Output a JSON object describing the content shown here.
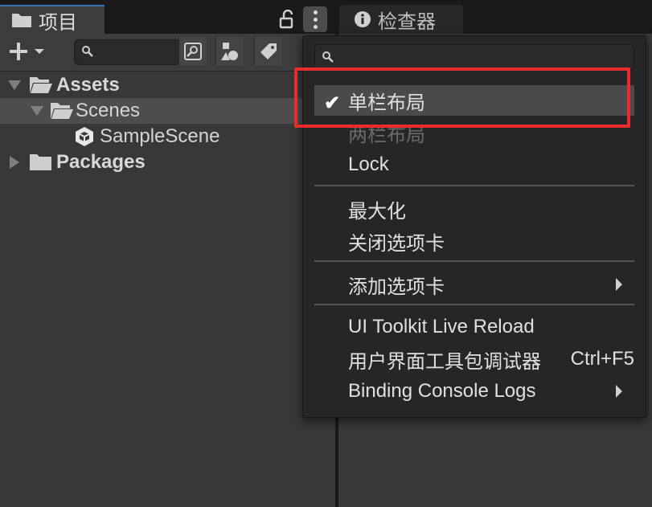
{
  "tabs": {
    "project_label": "项目",
    "inspector_label": "检查器"
  },
  "tree": {
    "items": [
      {
        "label": "Assets"
      },
      {
        "label": "Scenes"
      },
      {
        "label": "SampleScene"
      },
      {
        "label": "Packages"
      }
    ]
  },
  "menu": {
    "items": [
      {
        "label": "单栏布局",
        "checked": true
      },
      {
        "label": "两栏布局",
        "disabled": true
      },
      {
        "label": "Lock"
      },
      {
        "label": "最大化"
      },
      {
        "label": "关闭选项卡"
      },
      {
        "label": "添加选项卡",
        "submenu": true
      },
      {
        "label": "UI Toolkit Live Reload"
      },
      {
        "label": "用户界面工具包调试器",
        "shortcut": "Ctrl+F5"
      },
      {
        "label": "Binding Console Logs",
        "submenu": true
      }
    ]
  },
  "colors": {
    "highlight": "#ea2c2c",
    "selected_row": "#4d4d4d"
  }
}
